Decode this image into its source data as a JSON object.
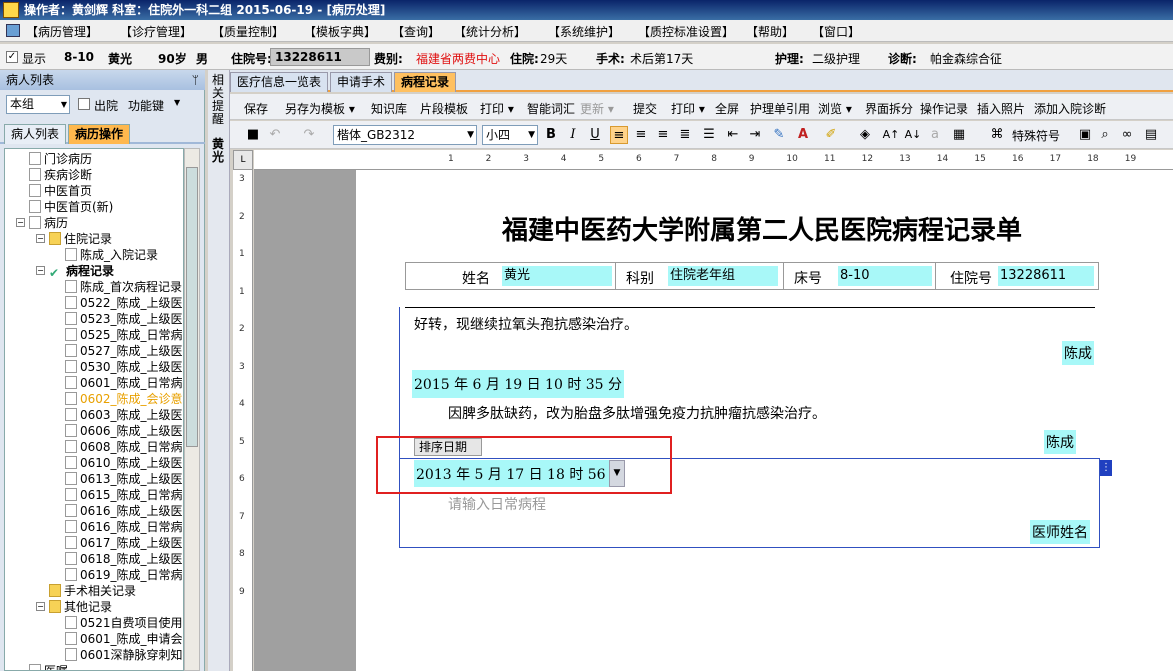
{
  "window": {
    "title": "操作者：黄剑辉   科室：住院外一科二组   2015-06-19 - [病历处理]"
  },
  "menu": [
    "【病历管理】",
    "【诊疗管理】",
    "【质量控制】",
    "【模板字典】",
    "【查询】",
    "【统计分析】",
    "【系统维护】",
    "【质控标准设置】",
    "【帮助】",
    "【窗口】"
  ],
  "patient": {
    "show_label": "显示",
    "bed": "8-10",
    "name": "黄光",
    "age": "90岁",
    "sex": "男",
    "inpatient_no_label": "住院号:",
    "inpatient_no": "13228611",
    "fee_label": "费别:",
    "fee": "福建省两费中心",
    "stay_label": "住院:",
    "stay": "29天",
    "surgery_label": "手术:",
    "surgery": "术后第17天",
    "nursing_label": "护理:",
    "nursing": "二级护理",
    "diag_label": "诊断:",
    "diag": "帕金森综合征"
  },
  "left": {
    "header": "病人列表",
    "pin": "ᛘ",
    "group": "本组",
    "discharged": "出院",
    "func": "功能键",
    "tabs": [
      "病人列表",
      "病历操作"
    ]
  },
  "tree": [
    "门诊病历",
    "疾病诊断",
    "中医首页",
    "中医首页(新)",
    "病历",
    "住院记录",
    "陈成_入院记录",
    "病程记录",
    "陈成_首次病程记录",
    "0522_陈成_上级医",
    "0523_陈成_上级医",
    "0525_陈成_日常病",
    "0527_陈成_上级医",
    "0530_陈成_上级医",
    "0601_陈成_日常病",
    "0602_陈成_会诊意",
    "0603_陈成_上级医",
    "0606_陈成_上级医",
    "0608_陈成_日常病",
    "0610_陈成_上级医",
    "0613_陈成_上级医",
    "0615_陈成_日常病",
    "0616_陈成_上级医",
    "0616_陈成_日常病",
    "0617_陈成_上级医",
    "0618_陈成_上级医",
    "0619_陈成_日常病",
    "手术相关记录",
    "其他记录",
    "0521自费项目使用",
    "0601_陈成_申请会",
    "0601深静脉穿刺知",
    "医嘱"
  ],
  "side": {
    "tab1": "相关提醒",
    "tab2": "黄光"
  },
  "doctabs": [
    "医疗信息一览表",
    "申请手术",
    "病程记录"
  ],
  "toolbar1": [
    "保存",
    "另存为模板 ▾",
    "知识库",
    "片段模板",
    "打印 ▾",
    "智能词汇",
    "更新 ▾",
    "提交",
    "打印 ▾",
    "全屏",
    "护理单引用",
    "浏览 ▾",
    "界面拆分",
    "操作记录",
    "插入照片",
    "添加入院诊断"
  ],
  "toolbar2": {
    "font": "楷体_GB2312",
    "size": "小四",
    "special": "特殊符号"
  },
  "ruler_h": [
    "1",
    "2",
    "3",
    "4",
    "5",
    "6",
    "7",
    "8",
    "9",
    "10",
    "11",
    "12",
    "13",
    "14",
    "15",
    "16",
    "17",
    "18",
    "19"
  ],
  "ruler_v": [
    "3",
    "2",
    "1",
    "1",
    "2",
    "3",
    "4",
    "5",
    "6",
    "7",
    "8",
    "9"
  ],
  "doc": {
    "title": "福建中医药大学附属第二人民医院病程记录单",
    "name_label": "姓名",
    "name": "黄光",
    "dept_label": "科别",
    "dept": "住院老年组",
    "bed_label": "床号",
    "bed": "8-10",
    "no_label": "住院号",
    "no": "13228611",
    "line1": "好转，现继续拉氧头孢抗感染治疗。",
    "sign": "陈成",
    "date1": "2015 年 6 月 19 日 10 时 35 分",
    "line2": "因脾多肽缺药，改为胎盘多肽增强免疫力抗肿瘤抗感染治疗。",
    "sort_label": "排序日期",
    "date2": "2013 年 5 月 17 日 18 时 56 分",
    "placeholder": "请输入日常病程",
    "doctor": "医师姓名"
  }
}
